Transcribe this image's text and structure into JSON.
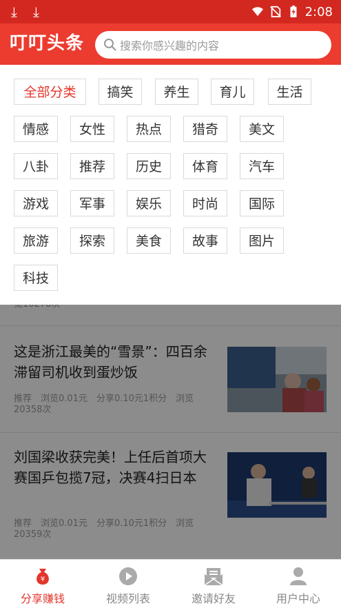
{
  "status_bar": {
    "time": "2:08",
    "icons": [
      "download-icon",
      "download-icon",
      "wifi-icon",
      "no-sim-icon",
      "battery-icon"
    ]
  },
  "header": {
    "app_title": "叮叮头条",
    "search_placeholder": "搜索你感兴趣的内容"
  },
  "categories": [
    "全部分类",
    "搞笑",
    "养生",
    "育儿",
    "生活",
    "情感",
    "女性",
    "热点",
    "猎奇",
    "美文",
    "八卦",
    "推荐",
    "历史",
    "体育",
    "汽车",
    "游戏",
    "军事",
    "娱乐",
    "时尚",
    "国际",
    "旅游",
    "探索",
    "美食",
    "故事",
    "图片",
    "科技"
  ],
  "selected_category": "全部分类",
  "feed": {
    "partial_meta": "览10278次",
    "articles": [
      {
        "title": "这是浙江最美的“雪景”：四百余滞留司机收到蛋炒饭",
        "meta": "推荐　浏览0.01元　分享0.10元1积分　浏览20358次"
      },
      {
        "title": "刘国梁收获完美！上任后首项大赛国乒包揽7冠，决赛4扫日本",
        "meta": "推荐　浏览0.01元　分享0.10元1积分　浏览20359次"
      }
    ]
  },
  "bottom_nav": {
    "tabs": [
      {
        "label": "分享赚钱",
        "icon": "money-bag-icon"
      },
      {
        "label": "视频列表",
        "icon": "play-icon"
      },
      {
        "label": "邀请好友",
        "icon": "mail-icon"
      },
      {
        "label": "用户中心",
        "icon": "user-icon"
      }
    ]
  },
  "colors": {
    "accent": "#e3362b",
    "header": "#ec3b2f",
    "status": "#d2281f"
  }
}
